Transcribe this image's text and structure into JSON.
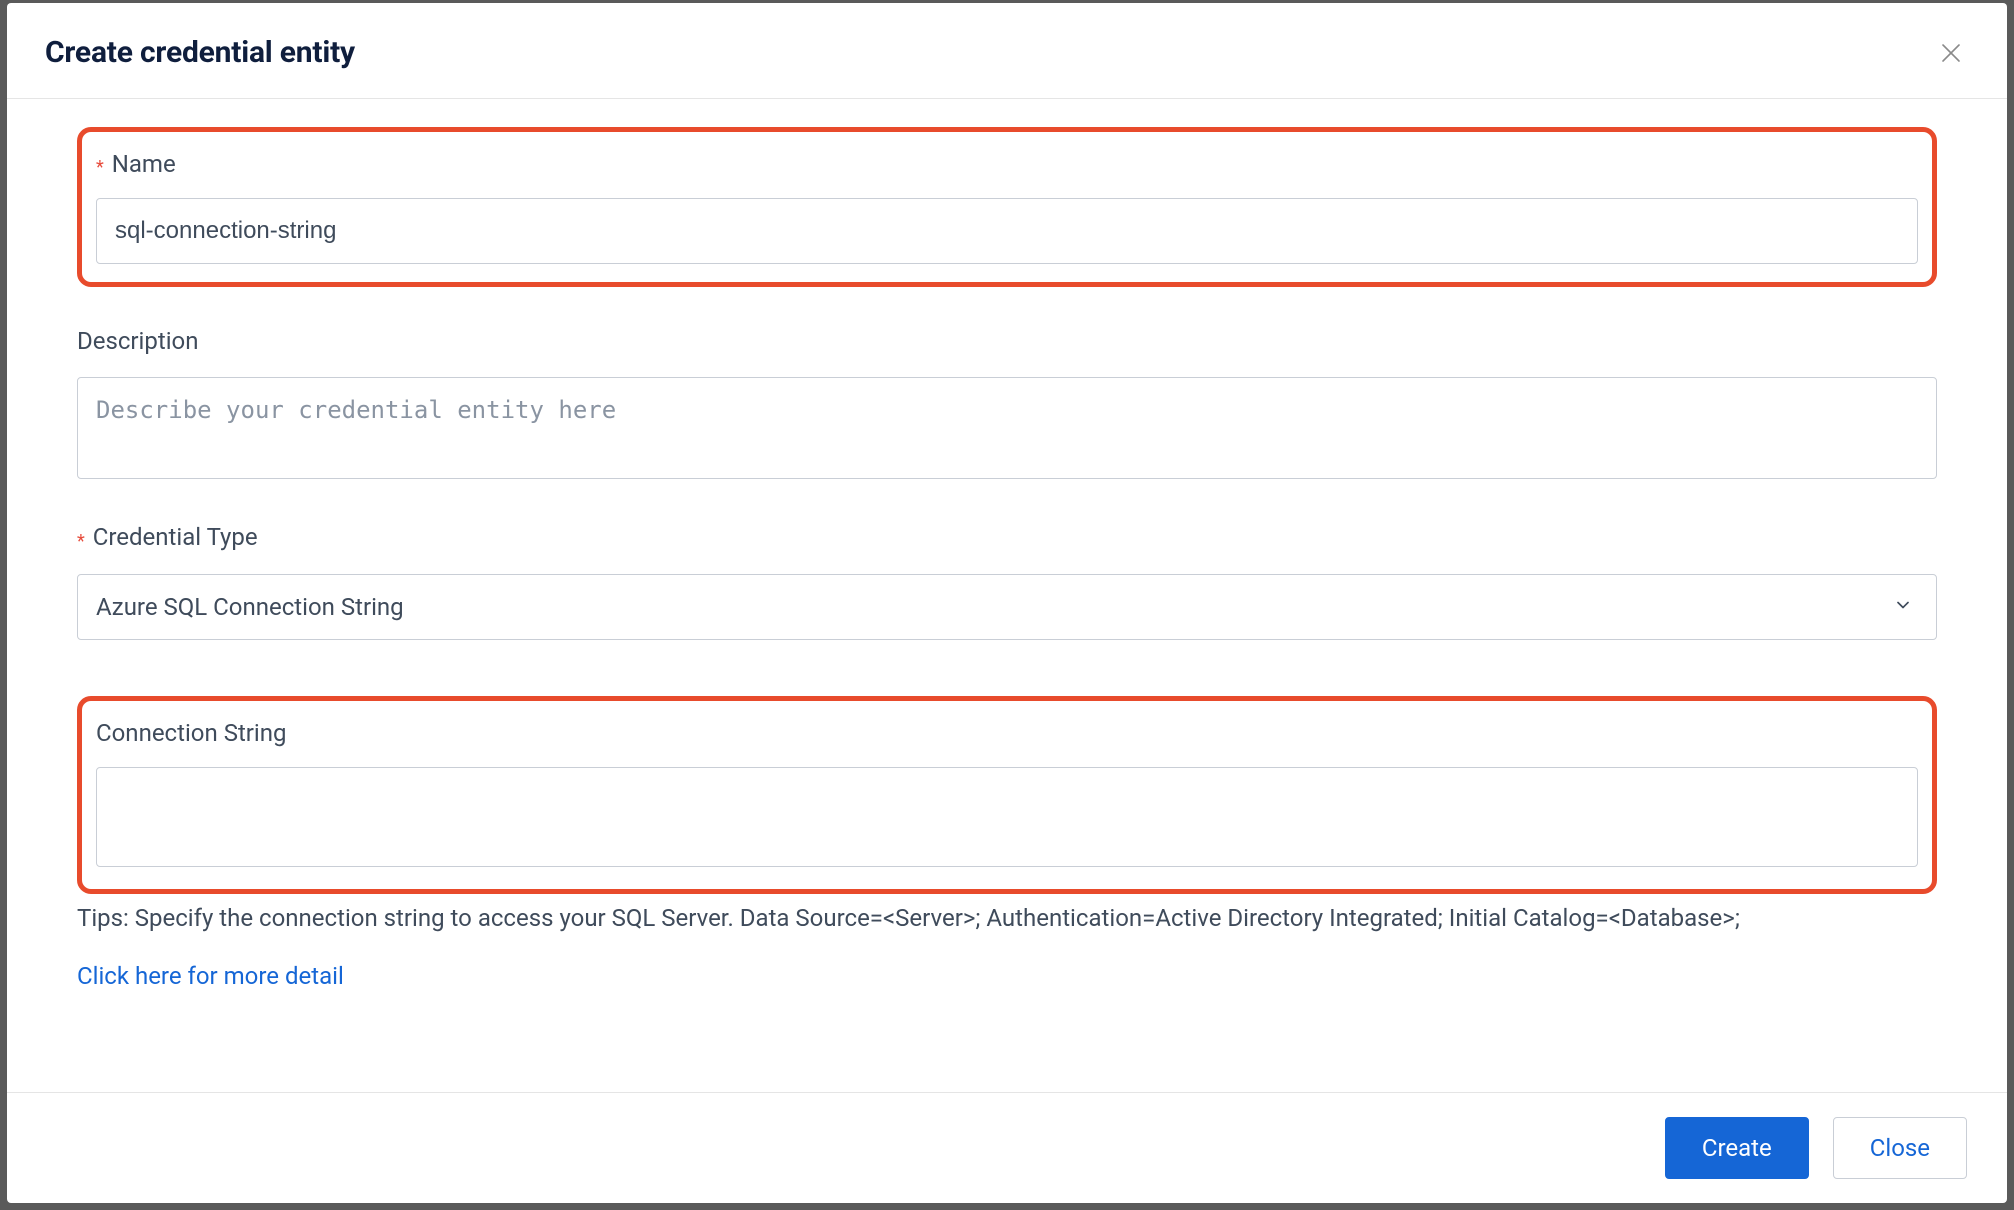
{
  "modal": {
    "title": "Create credential entity"
  },
  "fields": {
    "name": {
      "label": "Name",
      "value": "sql-connection-string"
    },
    "description": {
      "label": "Description",
      "placeholder": "Describe your credential entity here",
      "value": ""
    },
    "credentialType": {
      "label": "Credential Type",
      "selected": "Azure SQL Connection String"
    },
    "connectionString": {
      "label": "Connection String",
      "value": ""
    }
  },
  "tips": "Tips: Specify the connection string to access your SQL Server. Data Source=<Server>; Authentication=Active Directory Integrated; Initial Catalog=<Database>;",
  "link": "Click here for more detail",
  "footer": {
    "create": "Create",
    "close": "Close"
  }
}
